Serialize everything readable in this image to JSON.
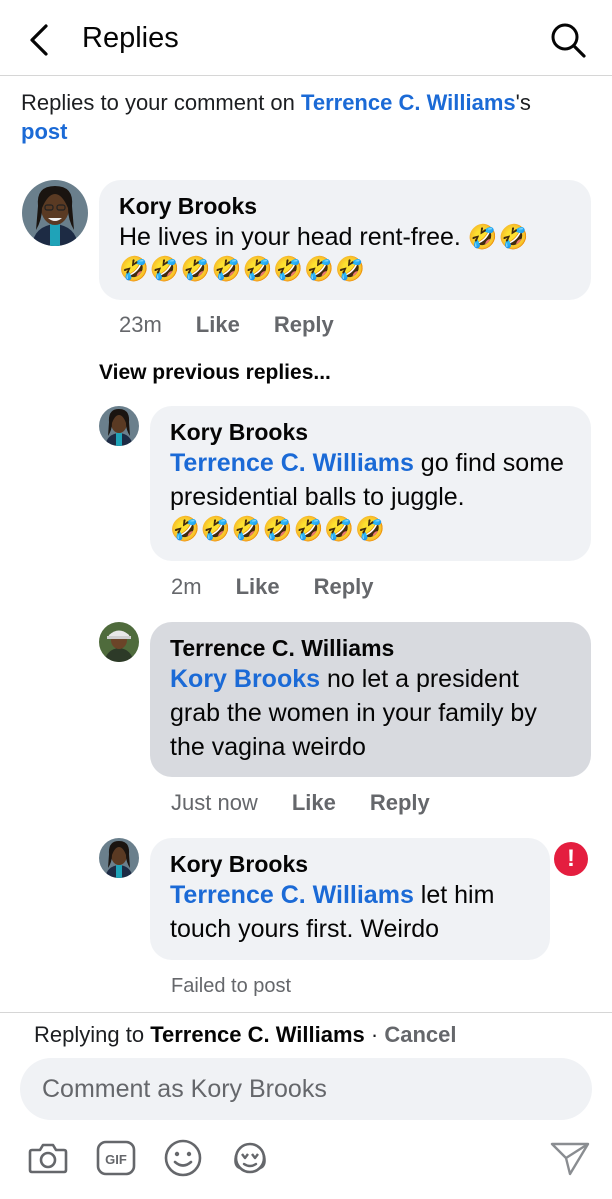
{
  "header": {
    "title": "Replies",
    "back_icon": "chevron-left-icon",
    "search_icon": "search-icon"
  },
  "context": {
    "prefix": "Replies to your comment on ",
    "name": "Terrence C. Williams",
    "suffix": "'s",
    "post": "post"
  },
  "main_comment": {
    "author": "Kory Brooks",
    "text": "He lives in your head rent-free.",
    "emoji_inline": "🤣🤣",
    "emoji_line": "🤣🤣🤣🤣🤣🤣🤣🤣",
    "time": "23m",
    "like": "Like",
    "reply": "Reply"
  },
  "view_previous": "View previous replies...",
  "replies": [
    {
      "author": "Kory Brooks",
      "mention": "Terrence C. Williams",
      "text": " go find some presidential balls to juggle.",
      "emoji": "🤣🤣🤣🤣🤣🤣🤣",
      "time": "2m",
      "like": "Like",
      "reply": "Reply"
    },
    {
      "author": "Terrence C. Williams",
      "mention": "Kory Brooks",
      "text": " no let a president grab the women in your family by the vagina weirdo",
      "time": "Just now",
      "like": "Like",
      "reply": "Reply"
    },
    {
      "author": "Kory Brooks",
      "mention": "Terrence C. Williams",
      "text": " let him touch yours first. Weirdo",
      "error_glyph": "!",
      "status": "Failed to post"
    }
  ],
  "composer": {
    "replying_prefix": "Replying to ",
    "replying_name": "Terrence C. Williams",
    "separator": " · ",
    "cancel": "Cancel",
    "placeholder": "Comment as Kory Brooks",
    "tools": [
      "camera-icon",
      "gif-icon",
      "emoji-icon",
      "avatar-sticker-icon",
      "send-icon"
    ]
  },
  "colors": {
    "link": "#1b6ad6",
    "bubble": "#f0f2f5",
    "bubble_highlight": "#d8dadf",
    "muted": "#65676b",
    "error": "#e41e3f"
  }
}
